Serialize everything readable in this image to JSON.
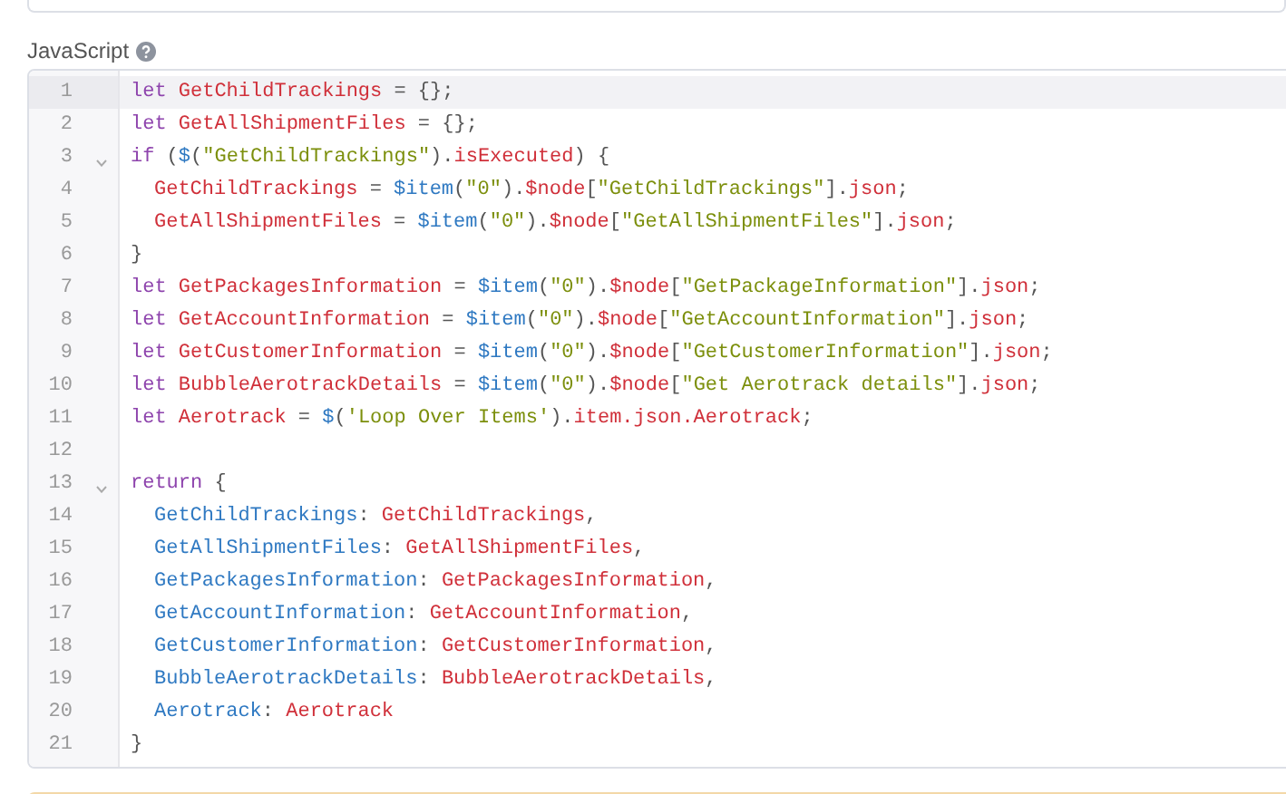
{
  "field_label": {
    "text": "JavaScript",
    "help": true
  },
  "editor": {
    "lines": [
      {
        "number": "1",
        "selected": true,
        "foldable": false,
        "indented": false,
        "tokens": [
          {
            "kind": "keyword",
            "text": "let "
          },
          {
            "kind": "variable",
            "text": "GetChildTrackings"
          },
          {
            "kind": "punct",
            "text": " = {};"
          }
        ]
      },
      {
        "number": "2",
        "selected": false,
        "foldable": false,
        "indented": false,
        "tokens": [
          {
            "kind": "keyword",
            "text": "let "
          },
          {
            "kind": "variable",
            "text": "GetAllShipmentFiles"
          },
          {
            "kind": "punct",
            "text": " = {};"
          }
        ]
      },
      {
        "number": "3",
        "selected": false,
        "foldable": true,
        "indented": false,
        "tokens": [
          {
            "kind": "keyword",
            "text": "if"
          },
          {
            "kind": "punct",
            "text": " ("
          },
          {
            "kind": "function",
            "text": "$"
          },
          {
            "kind": "punct",
            "text": "("
          },
          {
            "kind": "string",
            "text": "\"GetChildTrackings\""
          },
          {
            "kind": "punct",
            "text": ")."
          },
          {
            "kind": "variable",
            "text": "isExecuted"
          },
          {
            "kind": "punct",
            "text": ") {"
          }
        ]
      },
      {
        "number": "4",
        "selected": false,
        "foldable": false,
        "indented": true,
        "tokens": [
          {
            "kind": "variable",
            "text": "GetChildTrackings"
          },
          {
            "kind": "punct",
            "text": " = "
          },
          {
            "kind": "function",
            "text": "$item"
          },
          {
            "kind": "punct",
            "text": "("
          },
          {
            "kind": "string",
            "text": "\"0\""
          },
          {
            "kind": "punct",
            "text": ")."
          },
          {
            "kind": "variable",
            "text": "$node"
          },
          {
            "kind": "punct",
            "text": "["
          },
          {
            "kind": "string",
            "text": "\"GetChildTrackings\""
          },
          {
            "kind": "punct",
            "text": "]."
          },
          {
            "kind": "variable",
            "text": "json"
          },
          {
            "kind": "punct",
            "text": ";"
          }
        ]
      },
      {
        "number": "5",
        "selected": false,
        "foldable": false,
        "indented": true,
        "tokens": [
          {
            "kind": "variable",
            "text": "GetAllShipmentFiles"
          },
          {
            "kind": "punct",
            "text": " = "
          },
          {
            "kind": "function",
            "text": "$item"
          },
          {
            "kind": "punct",
            "text": "("
          },
          {
            "kind": "string",
            "text": "\"0\""
          },
          {
            "kind": "punct",
            "text": ")."
          },
          {
            "kind": "variable",
            "text": "$node"
          },
          {
            "kind": "punct",
            "text": "["
          },
          {
            "kind": "string",
            "text": "\"GetAllShipmentFiles\""
          },
          {
            "kind": "punct",
            "text": "]."
          },
          {
            "kind": "variable",
            "text": "json"
          },
          {
            "kind": "punct",
            "text": ";"
          }
        ]
      },
      {
        "number": "6",
        "selected": false,
        "foldable": false,
        "indented": false,
        "tokens": [
          {
            "kind": "punct",
            "text": "}"
          }
        ]
      },
      {
        "number": "7",
        "selected": false,
        "foldable": false,
        "indented": false,
        "tokens": [
          {
            "kind": "keyword",
            "text": "let "
          },
          {
            "kind": "variable",
            "text": "GetPackagesInformation"
          },
          {
            "kind": "punct",
            "text": " = "
          },
          {
            "kind": "function",
            "text": "$item"
          },
          {
            "kind": "punct",
            "text": "("
          },
          {
            "kind": "string",
            "text": "\"0\""
          },
          {
            "kind": "punct",
            "text": ")."
          },
          {
            "kind": "variable",
            "text": "$node"
          },
          {
            "kind": "punct",
            "text": "["
          },
          {
            "kind": "string",
            "text": "\"GetPackageInformation\""
          },
          {
            "kind": "punct",
            "text": "]."
          },
          {
            "kind": "variable",
            "text": "json"
          },
          {
            "kind": "punct",
            "text": ";"
          }
        ]
      },
      {
        "number": "8",
        "selected": false,
        "foldable": false,
        "indented": false,
        "tokens": [
          {
            "kind": "keyword",
            "text": "let "
          },
          {
            "kind": "variable",
            "text": "GetAccountInformation"
          },
          {
            "kind": "punct",
            "text": " = "
          },
          {
            "kind": "function",
            "text": "$item"
          },
          {
            "kind": "punct",
            "text": "("
          },
          {
            "kind": "string",
            "text": "\"0\""
          },
          {
            "kind": "punct",
            "text": ")."
          },
          {
            "kind": "variable",
            "text": "$node"
          },
          {
            "kind": "punct",
            "text": "["
          },
          {
            "kind": "string",
            "text": "\"GetAccountInformation\""
          },
          {
            "kind": "punct",
            "text": "]."
          },
          {
            "kind": "variable",
            "text": "json"
          },
          {
            "kind": "punct",
            "text": ";"
          }
        ]
      },
      {
        "number": "9",
        "selected": false,
        "foldable": false,
        "indented": false,
        "tokens": [
          {
            "kind": "keyword",
            "text": "let "
          },
          {
            "kind": "variable",
            "text": "GetCustomerInformation"
          },
          {
            "kind": "punct",
            "text": " = "
          },
          {
            "kind": "function",
            "text": "$item"
          },
          {
            "kind": "punct",
            "text": "("
          },
          {
            "kind": "string",
            "text": "\"0\""
          },
          {
            "kind": "punct",
            "text": ")."
          },
          {
            "kind": "variable",
            "text": "$node"
          },
          {
            "kind": "punct",
            "text": "["
          },
          {
            "kind": "string",
            "text": "\"GetCustomerInformation\""
          },
          {
            "kind": "punct",
            "text": "]."
          },
          {
            "kind": "variable",
            "text": "json"
          },
          {
            "kind": "punct",
            "text": ";"
          }
        ]
      },
      {
        "number": "10",
        "selected": false,
        "foldable": false,
        "indented": false,
        "tokens": [
          {
            "kind": "keyword",
            "text": "let "
          },
          {
            "kind": "variable",
            "text": "BubbleAerotrackDetails"
          },
          {
            "kind": "punct",
            "text": " = "
          },
          {
            "kind": "function",
            "text": "$item"
          },
          {
            "kind": "punct",
            "text": "("
          },
          {
            "kind": "string",
            "text": "\"0\""
          },
          {
            "kind": "punct",
            "text": ")."
          },
          {
            "kind": "variable",
            "text": "$node"
          },
          {
            "kind": "punct",
            "text": "["
          },
          {
            "kind": "string",
            "text": "\"Get Aerotrack details\""
          },
          {
            "kind": "punct",
            "text": "]."
          },
          {
            "kind": "variable",
            "text": "json"
          },
          {
            "kind": "punct",
            "text": ";"
          }
        ]
      },
      {
        "number": "11",
        "selected": false,
        "foldable": false,
        "indented": false,
        "tokens": [
          {
            "kind": "keyword",
            "text": "let "
          },
          {
            "kind": "variable",
            "text": "Aerotrack"
          },
          {
            "kind": "punct",
            "text": " = "
          },
          {
            "kind": "function",
            "text": "$"
          },
          {
            "kind": "punct",
            "text": "("
          },
          {
            "kind": "string",
            "text": "'Loop Over Items'"
          },
          {
            "kind": "punct",
            "text": ")."
          },
          {
            "kind": "variable",
            "text": "item.json.Aerotrack"
          },
          {
            "kind": "punct",
            "text": ";"
          }
        ]
      },
      {
        "number": "12",
        "selected": false,
        "foldable": false
      },
      {
        "number": "13",
        "selected": false,
        "foldable": true,
        "indented": false,
        "tokens": [
          {
            "kind": "keyword",
            "text": "return"
          },
          {
            "kind": "punct",
            "text": " {"
          }
        ]
      },
      {
        "number": "14",
        "selected": false,
        "foldable": false,
        "indented": true,
        "tokens": [
          {
            "kind": "property",
            "text": "GetChildTrackings"
          },
          {
            "kind": "punct",
            "text": ": "
          },
          {
            "kind": "variable",
            "text": "GetChildTrackings"
          },
          {
            "kind": "punct",
            "text": ","
          }
        ]
      },
      {
        "number": "15",
        "selected": false,
        "foldable": false,
        "indented": true,
        "tokens": [
          {
            "kind": "property",
            "text": "GetAllShipmentFiles"
          },
          {
            "kind": "punct",
            "text": ": "
          },
          {
            "kind": "variable",
            "text": "GetAllShipmentFiles"
          },
          {
            "kind": "punct",
            "text": ","
          }
        ]
      },
      {
        "number": "16",
        "selected": false,
        "foldable": false,
        "indented": true,
        "tokens": [
          {
            "kind": "property",
            "text": "GetPackagesInformation"
          },
          {
            "kind": "punct",
            "text": ": "
          },
          {
            "kind": "variable",
            "text": "GetPackagesInformation"
          },
          {
            "kind": "punct",
            "text": ","
          }
        ]
      },
      {
        "number": "17",
        "selected": false,
        "foldable": false,
        "indented": true,
        "tokens": [
          {
            "kind": "property",
            "text": "GetAccountInformation"
          },
          {
            "kind": "punct",
            "text": ": "
          },
          {
            "kind": "variable",
            "text": "GetAccountInformation"
          },
          {
            "kind": "punct",
            "text": ","
          }
        ]
      },
      {
        "number": "18",
        "selected": false,
        "foldable": false,
        "indented": true,
        "tokens": [
          {
            "kind": "property",
            "text": "GetCustomerInformation"
          },
          {
            "kind": "punct",
            "text": ": "
          },
          {
            "kind": "variable",
            "text": "GetCustomerInformation"
          },
          {
            "kind": "punct",
            "text": ","
          }
        ]
      },
      {
        "number": "19",
        "selected": false,
        "foldable": false,
        "indented": true,
        "tokens": [
          {
            "kind": "property",
            "text": "BubbleAerotrackDetails"
          },
          {
            "kind": "punct",
            "text": ": "
          },
          {
            "kind": "variable",
            "text": "BubbleAerotrackDetails"
          },
          {
            "kind": "punct",
            "text": ","
          }
        ]
      },
      {
        "number": "20",
        "selected": false,
        "foldable": false,
        "indented": true,
        "tokens": [
          {
            "kind": "property",
            "text": "Aerotrack"
          },
          {
            "kind": "punct",
            "text": ": "
          },
          {
            "kind": "variable",
            "text": "Aerotrack"
          }
        ]
      },
      {
        "number": "21",
        "selected": false,
        "foldable": false,
        "indented": false,
        "tokens": [
          {
            "kind": "punct",
            "text": "}"
          }
        ]
      }
    ]
  }
}
